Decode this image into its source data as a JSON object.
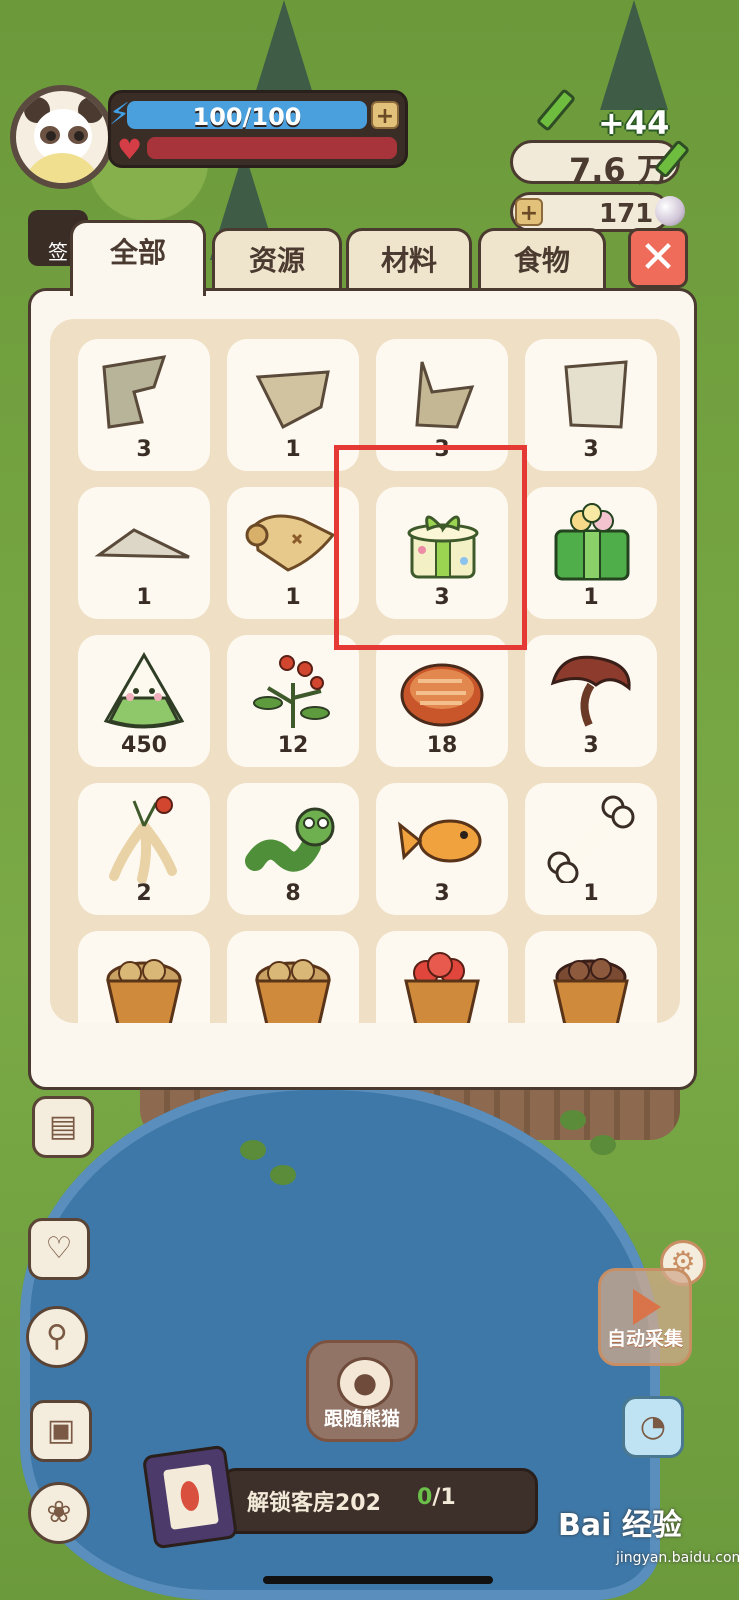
{
  "hud": {
    "energy_text": "100/100",
    "energy_fraction": 1.0,
    "gain_text": "+44",
    "resource_1": "7.6 万",
    "resource_2": "171",
    "sign_label": "签"
  },
  "tabs": [
    {
      "label": "全部",
      "active": true
    },
    {
      "label": "资源",
      "active": false
    },
    {
      "label": "材料",
      "active": false
    },
    {
      "label": "食物",
      "active": false
    }
  ],
  "close_label": "✕",
  "inventory": [
    {
      "icon": "map-fragment-icon",
      "count": "3"
    },
    {
      "icon": "map-fragment-icon",
      "count": "1"
    },
    {
      "icon": "map-fragment-icon",
      "count": "3"
    },
    {
      "icon": "map-fragment-icon",
      "count": "3"
    },
    {
      "icon": "map-fragment-icon",
      "count": "1"
    },
    {
      "icon": "treasure-map-icon",
      "count": "1"
    },
    {
      "icon": "gift-box-icon",
      "count": "3"
    },
    {
      "icon": "flower-gift-box-icon",
      "count": "1"
    },
    {
      "icon": "rice-dumpling-icon",
      "count": "450"
    },
    {
      "icon": "berry-herb-icon",
      "count": "12"
    },
    {
      "icon": "grilled-meat-icon",
      "count": "18"
    },
    {
      "icon": "mushroom-icon",
      "count": "3"
    },
    {
      "icon": "ginseng-icon",
      "count": "2"
    },
    {
      "icon": "worm-icon",
      "count": "8"
    },
    {
      "icon": "fish-icon",
      "count": "3"
    },
    {
      "icon": "bone-icon",
      "count": "1"
    },
    {
      "icon": "potato-basket-icon",
      "count": ""
    },
    {
      "icon": "potato-basket-icon",
      "count": ""
    },
    {
      "icon": "apple-basket-icon",
      "count": ""
    },
    {
      "icon": "nut-basket-icon",
      "count": ""
    }
  ],
  "buttons": {
    "auto_collect": "自动采集",
    "follow_panda": "跟随熊猫"
  },
  "bottom_bar": {
    "label": "解锁客房202",
    "done": "0",
    "total": "/1"
  },
  "watermark": {
    "main": "Bai 经验",
    "sub": "jingyan.baidu.com"
  },
  "colors": {
    "panel_bg": "#fbf7ee",
    "grid_bg": "#efdfc4",
    "highlight": "#e53935",
    "close_bg": "#ef6c5a",
    "energy": "#4aa0dd",
    "health": "#a8343b"
  }
}
